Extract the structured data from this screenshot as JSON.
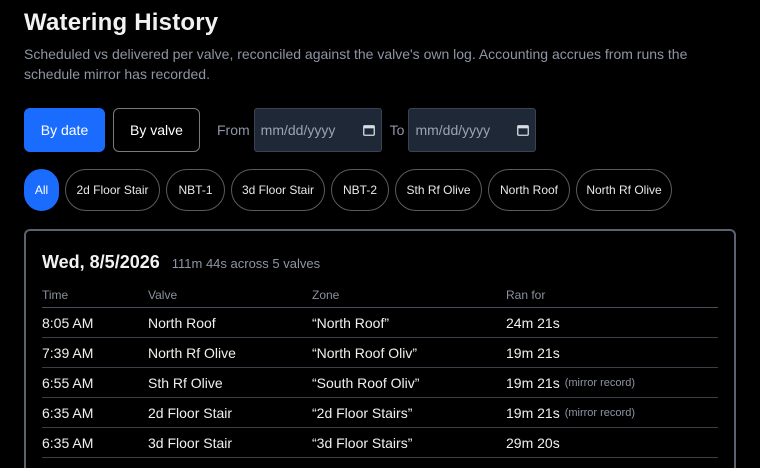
{
  "header": {
    "title": "Watering History",
    "subtitle": "Scheduled vs delivered per valve, reconciled against the valve's own log. Accounting accrues from runs the schedule mirror has recorded."
  },
  "controls": {
    "by_date_label": "By date",
    "by_valve_label": "By valve",
    "from_label": "From",
    "to_label": "To",
    "from_placeholder": "mm/dd/yyyy",
    "to_placeholder": "mm/dd/yyyy"
  },
  "filters": [
    "All",
    "2d Floor Stair",
    "NBT-1",
    "3d Floor Stair",
    "NBT-2",
    "Sth Rf Olive",
    "North Roof",
    "North Rf Olive"
  ],
  "filter_active_index": 0,
  "day_card": {
    "date": "Wed, 8/5/2026",
    "summary": "111m 44s across 5 valves",
    "columns": [
      "Time",
      "Valve",
      "Zone",
      "Ran for"
    ],
    "rows": [
      {
        "time": "8:05 AM",
        "valve": "North Roof",
        "zone": "“North Roof”",
        "ran_for": "24m 21s",
        "note": ""
      },
      {
        "time": "7:39 AM",
        "valve": "North Rf Olive",
        "zone": "“North Roof Oliv”",
        "ran_for": "19m 21s",
        "note": ""
      },
      {
        "time": "6:55 AM",
        "valve": "Sth Rf Olive",
        "zone": "“South Roof Oliv”",
        "ran_for": "19m 21s",
        "note": "(mirror record)"
      },
      {
        "time": "6:35 AM",
        "valve": "2d Floor Stair",
        "zone": "“2d Floor Stairs”",
        "ran_for": "19m 21s",
        "note": "(mirror record)"
      },
      {
        "time": "6:35 AM",
        "valve": "3d Floor Stair",
        "zone": "“3d Floor Stairs”",
        "ran_for": "29m 20s",
        "note": ""
      }
    ]
  },
  "colors": {
    "accent": "#1a6cff",
    "background": "#000000",
    "muted_text": "#8e95a4"
  }
}
